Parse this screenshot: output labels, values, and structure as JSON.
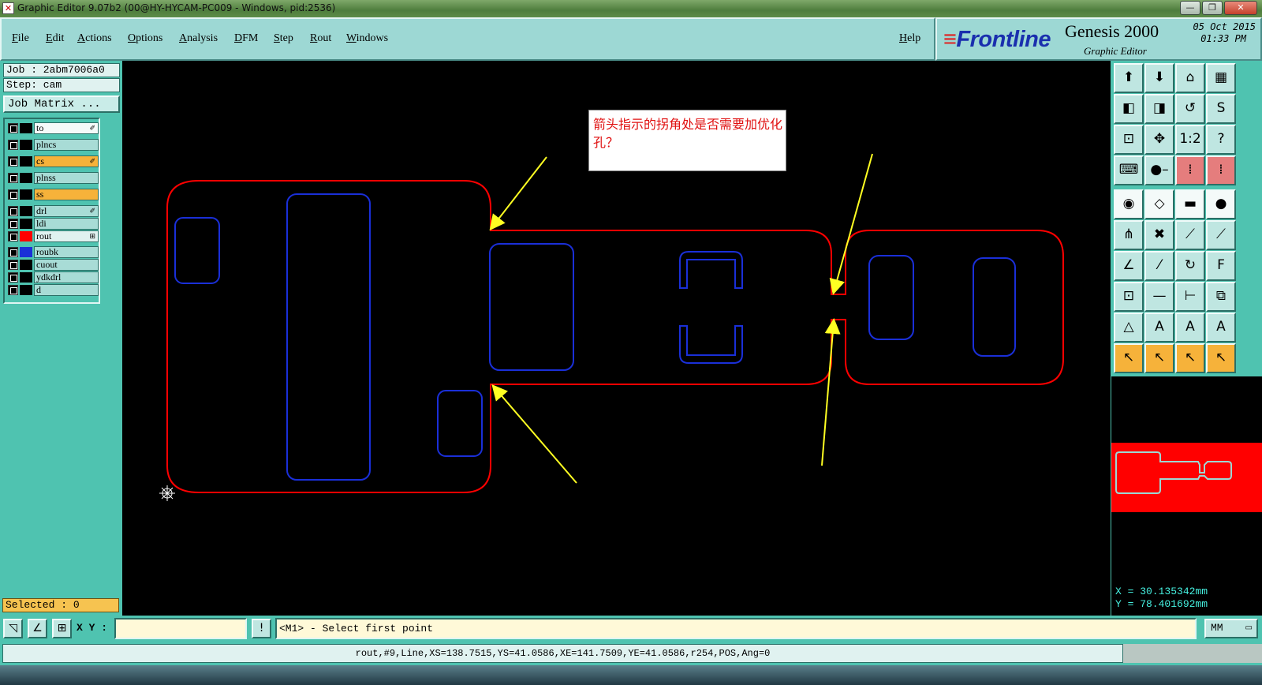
{
  "window": {
    "title": "Graphic Editor 9.07b2 (00@HY-HYCAM-PC009 - Windows, pid:2536)",
    "app_icon_glyph": "✕",
    "controls": [
      "—",
      "❐",
      "✕"
    ]
  },
  "menu": {
    "items": [
      "File",
      "Edit",
      "Actions",
      "Options",
      "Analysis",
      "DFM",
      "Step",
      "Rout",
      "Windows"
    ],
    "help": "Help"
  },
  "logo": {
    "brand": "Frontline",
    "product": "Genesis 2000",
    "subtitle": "Graphic Editor",
    "date": "05 Oct 2015",
    "time": "01:33 PM"
  },
  "job": {
    "job_label": "Job : 2abm7006a0",
    "step_label": "Step: cam",
    "matrix_button": "Job Matrix ..."
  },
  "layers": [
    {
      "name": "to",
      "swatch": "#000000",
      "bg": "#f4faf9",
      "mark": "✐",
      "checked": true
    },
    {
      "name": "plncs",
      "swatch": "#000000",
      "bg": "#a8dcd6",
      "mark": "",
      "checked": true
    },
    {
      "name": "cs",
      "swatch": "#000000",
      "bg": "#f6b23a",
      "mark": "✐",
      "checked": true
    },
    {
      "name": "plnss",
      "swatch": "#000000",
      "bg": "#a8dcd6",
      "mark": "",
      "checked": true
    },
    {
      "name": "ss",
      "swatch": "#000000",
      "bg": "#f6b23a",
      "mark": "",
      "checked": true
    },
    {
      "name": "drl",
      "swatch": "#000000",
      "bg": "#a8dcd6",
      "mark": "✐",
      "checked": true
    },
    {
      "name": "ldi",
      "swatch": "#000000",
      "bg": "#a8dcd6",
      "mark": "",
      "checked": true
    },
    {
      "name": "rout",
      "swatch": "#ff0000",
      "bg": "#e0f2f0",
      "mark": "⊞",
      "checked": true,
      "active": true
    },
    {
      "name": "roubk",
      "swatch": "#1a2fd8",
      "bg": "#a8dcd6",
      "mark": "",
      "checked": true
    },
    {
      "name": "cuout",
      "swatch": "#000000",
      "bg": "#a8dcd6",
      "mark": "",
      "checked": true
    },
    {
      "name": "ydkdrl",
      "swatch": "#000000",
      "bg": "#a8dcd6",
      "mark": "",
      "checked": true
    },
    {
      "name": "d",
      "swatch": "#000000",
      "bg": "#a8dcd6",
      "mark": "",
      "checked": true
    }
  ],
  "selected": "Selected : 0",
  "annotation": {
    "text": "箭头指示的拐角处是否需要加优化孔？"
  },
  "colors": {
    "rout_layer": "#ff0000",
    "roubk_layer": "#1a2fd8",
    "arrow": "#ffff22",
    "panel_bg": "#4fc3b0",
    "menu_bg": "#9dd8d4"
  },
  "toolbar": {
    "buttons": [
      {
        "name": "zoom-home-icon",
        "glyph": "⬆",
        "style": ""
      },
      {
        "name": "zoom-down-icon",
        "glyph": "⬇",
        "style": ""
      },
      {
        "name": "home-icon",
        "glyph": "⌂",
        "style": ""
      },
      {
        "name": "grid-icon",
        "glyph": "▦",
        "style": ""
      },
      {
        "name": "pan-left-icon",
        "glyph": "◧",
        "style": ""
      },
      {
        "name": "pan-right-icon",
        "glyph": "◨",
        "style": ""
      },
      {
        "name": "undo-zoom-icon",
        "glyph": "↺",
        "style": ""
      },
      {
        "name": "s-curve-icon",
        "glyph": "S",
        "style": ""
      },
      {
        "name": "fit-icon",
        "glyph": "⊡",
        "style": ""
      },
      {
        "name": "center-icon",
        "glyph": "✥",
        "style": ""
      },
      {
        "name": "scale-icon",
        "glyph": "1:2",
        "style": ""
      },
      {
        "name": "help-icon",
        "glyph": "?",
        "style": ""
      },
      {
        "name": "pcb-icon",
        "glyph": "⌨",
        "style": ""
      },
      {
        "name": "probe-icon",
        "glyph": "●–",
        "style": ""
      },
      {
        "name": "layer-red-icon",
        "glyph": "⁞",
        "style": "red"
      },
      {
        "name": "layer-red2-icon",
        "glyph": "⁞",
        "style": "red"
      },
      {
        "name": "pad-icon",
        "glyph": "◉",
        "style": "white"
      },
      {
        "name": "shape-icon",
        "glyph": "◇",
        "style": "white"
      },
      {
        "name": "ruler-icon",
        "glyph": "▬",
        "style": "white"
      },
      {
        "name": "circle-icon",
        "glyph": "●",
        "style": "white"
      },
      {
        "name": "connect-icon",
        "glyph": "⋔",
        "style": ""
      },
      {
        "name": "cross-icon",
        "glyph": "✖",
        "style": ""
      },
      {
        "name": "line-point-icon",
        "glyph": "⟋",
        "style": ""
      },
      {
        "name": "line-point2-icon",
        "glyph": "⟋",
        "style": ""
      },
      {
        "name": "draw-line-icon",
        "glyph": "∠",
        "style": ""
      },
      {
        "name": "diagonal-icon",
        "glyph": "⁄",
        "style": ""
      },
      {
        "name": "arc-icon",
        "glyph": "↻",
        "style": ""
      },
      {
        "name": "ff-icon",
        "glyph": "F",
        "style": ""
      },
      {
        "name": "node-icon",
        "glyph": "⊡",
        "style": ""
      },
      {
        "name": "minus-icon",
        "glyph": "—",
        "style": ""
      },
      {
        "name": "measure-icon",
        "glyph": "⊢",
        "style": ""
      },
      {
        "name": "group-icon",
        "glyph": "⧉",
        "style": ""
      },
      {
        "name": "triangle-icon",
        "glyph": "△",
        "style": ""
      },
      {
        "name": "a-icon",
        "glyph": "A",
        "style": ""
      },
      {
        "name": "a2-icon",
        "glyph": "A",
        "style": ""
      },
      {
        "name": "a3-icon",
        "glyph": "A",
        "style": ""
      },
      {
        "name": "pointer-icon",
        "glyph": "↖",
        "style": "orange"
      },
      {
        "name": "pointer-box-icon",
        "glyph": "↖",
        "style": "orange"
      },
      {
        "name": "pointer-circle-icon",
        "glyph": "↖",
        "style": "orange"
      },
      {
        "name": "pointer-multi-icon",
        "glyph": "↖",
        "style": "orange"
      }
    ]
  },
  "coords": {
    "x": "X = 30.135342mm",
    "y": "Y = 78.401692mm"
  },
  "command": {
    "xy_label": "X Y :",
    "xy_value": "",
    "prompt": "<M1> - Select first point",
    "units": "MM",
    "units_dropdown": "▭"
  },
  "status": {
    "text": "rout,#9,Line,XS=138.7515,YS=41.0586,XE=141.7509,YE=41.0586,r254,POS,Ang=0"
  }
}
